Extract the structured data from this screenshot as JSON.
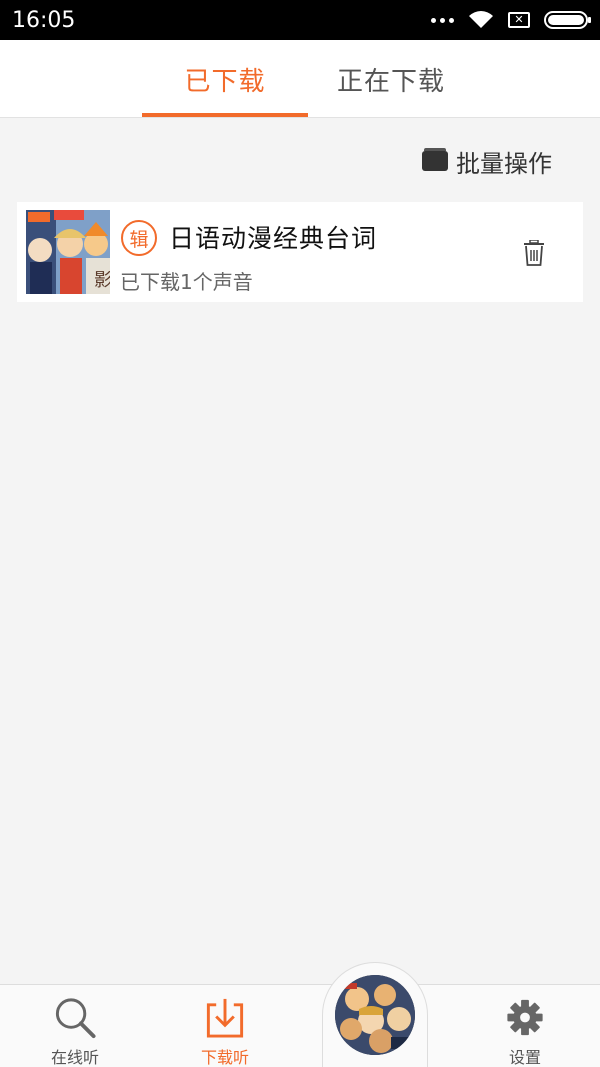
{
  "status_bar": {
    "time": "16:05",
    "icons": [
      "more-dots-icon",
      "wifi-icon",
      "no-sim-icon",
      "battery-icon"
    ]
  },
  "tabs": [
    {
      "label": "已下载",
      "active": true
    },
    {
      "label": "正在下载",
      "active": false
    }
  ],
  "accent_color": "#f26b2b",
  "batch": {
    "label": "批量操作",
    "icon": "folder-icon"
  },
  "albums": [
    {
      "badge": "辑",
      "title": "日语动漫经典台词",
      "subtitle": "已下载1个声音",
      "action_icon": "trash-icon"
    }
  ],
  "bottom_nav": [
    {
      "label": "在线听",
      "icon": "search-icon",
      "active": false
    },
    {
      "label": "下载听",
      "icon": "download-icon",
      "active": true
    },
    {
      "label": "",
      "icon": "player-disc",
      "active": false
    },
    {
      "label": "设置",
      "icon": "gear-icon",
      "active": false
    }
  ]
}
